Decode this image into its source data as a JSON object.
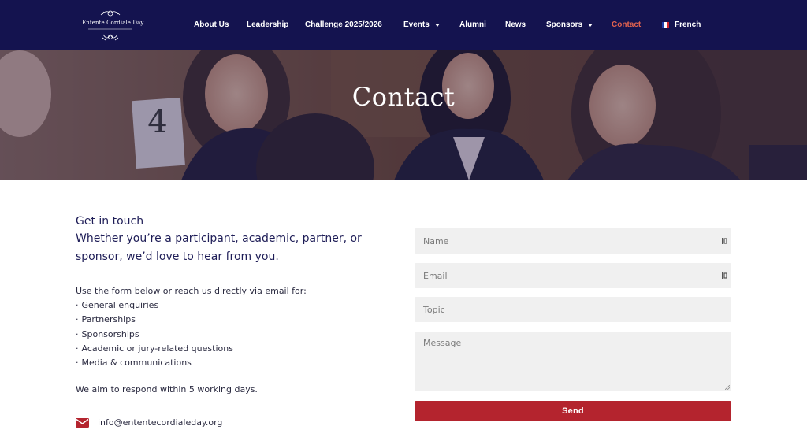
{
  "brand": {
    "logo_text": "Entente Cordiale Day"
  },
  "nav": {
    "about": "About Us",
    "leadership": "Leadership",
    "challenge": "Challenge 2025/2026",
    "events": "Events",
    "alumni": "Alumni",
    "news": "News",
    "sponsors": "Sponsors",
    "contact": "Contact",
    "language": "French"
  },
  "hero": {
    "title": "Contact",
    "table_number": "4"
  },
  "intro": {
    "heading": "Get in touch",
    "text": "Whether you’re a participant, academic, partner, or sponsor, we’d love to hear from you."
  },
  "body": {
    "lead": "Use the form below or reach us directly via email for:",
    "items": [
      "General enquiries",
      "Partnerships",
      "Sponsorships",
      "Academic or jury-related questions",
      "Media & communications"
    ],
    "bullet": "·",
    "respond": "We aim to respond within 5 working days.",
    "email": "info@ententecordialeday.org"
  },
  "form": {
    "name_placeholder": "Name",
    "email_placeholder": "Email",
    "topic_placeholder": "Topic",
    "message_placeholder": "Message",
    "send_label": "Send"
  },
  "colors": {
    "header_bg": "#14134f",
    "accent_red": "#b4242e",
    "active_nav": "#e0624f",
    "field_bg": "#f0f0f0"
  },
  "icons": {
    "email": "envelope-icon",
    "field_autofill": "autofill-key-icon",
    "caret": "chevron-down-icon",
    "flag": "french-flag-icon"
  }
}
